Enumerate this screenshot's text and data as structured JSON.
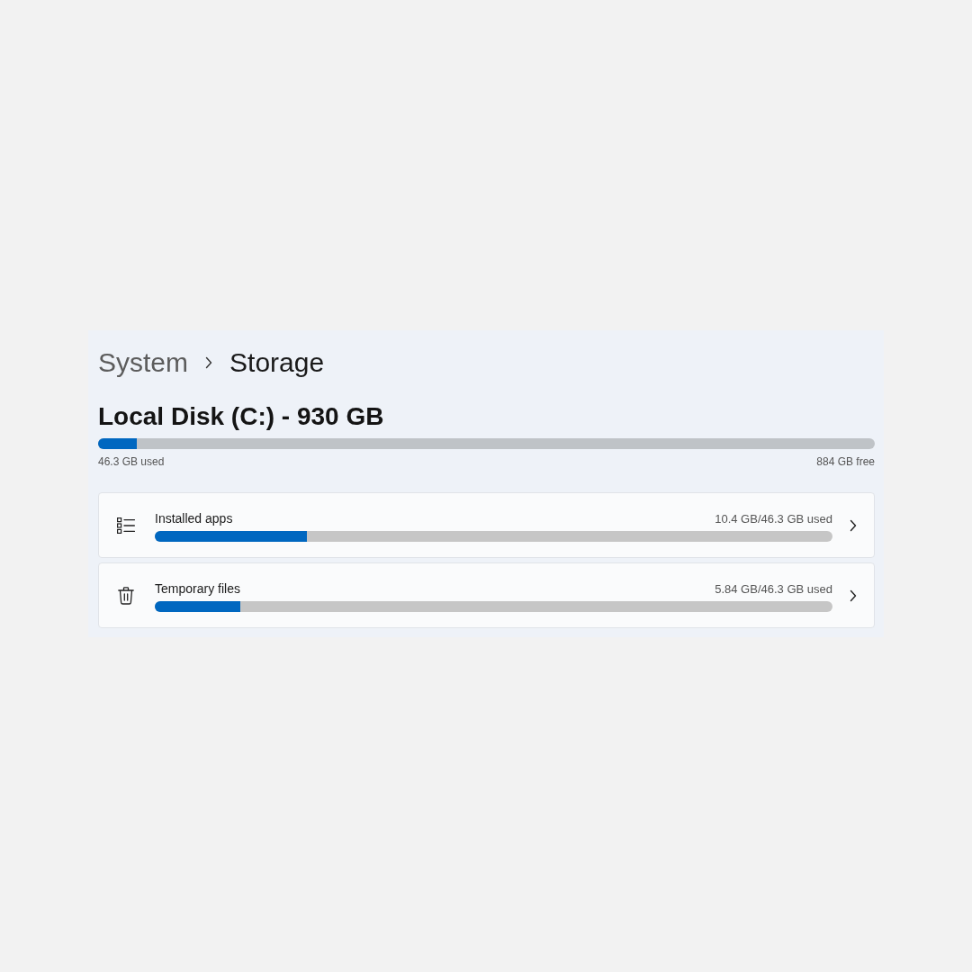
{
  "breadcrumb": {
    "parent": "System",
    "current": "Storage"
  },
  "disk": {
    "title": "Local Disk (C:) - 930 GB",
    "level": 0.05,
    "used": "46.3 GB used",
    "free": "884 GB free"
  },
  "categories": [
    {
      "label": "Installed apps",
      "reading": "10.4 GB/46.3 GB used",
      "level": 0.225
    },
    {
      "label": "Temporary files",
      "reading": "5.84 GB/46.3 GB used",
      "level": 0.126
    }
  ]
}
